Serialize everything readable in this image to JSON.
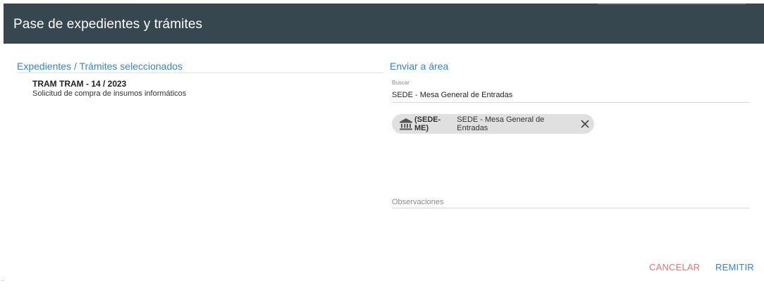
{
  "dialog": {
    "title": "Pase de expedientes y trámites"
  },
  "left": {
    "title": "Expedientes / Trámites seleccionados",
    "items": [
      {
        "code": "TRAM TRAM - 14 / 2023",
        "description": "Solicitud de compra de insumos informáticos"
      }
    ]
  },
  "right": {
    "title": "Enviar a área",
    "search": {
      "label": "Buscar",
      "value": "SEDE - Mesa General de Entradas"
    },
    "chip": {
      "icon": "bank-icon",
      "code": "(SEDE-ME)",
      "label": "SEDE - Mesa General de Entradas",
      "remove_icon": "close-icon"
    },
    "observations": {
      "placeholder": "Observaciones",
      "value": ""
    }
  },
  "actions": {
    "cancel_label": "CANCELAR",
    "submit_label": "REMITIR"
  },
  "colors": {
    "header_bg": "#37474f",
    "accent": "#2f86d6",
    "cancel": "#e57373",
    "chip_bg": "#e0e0e0"
  }
}
